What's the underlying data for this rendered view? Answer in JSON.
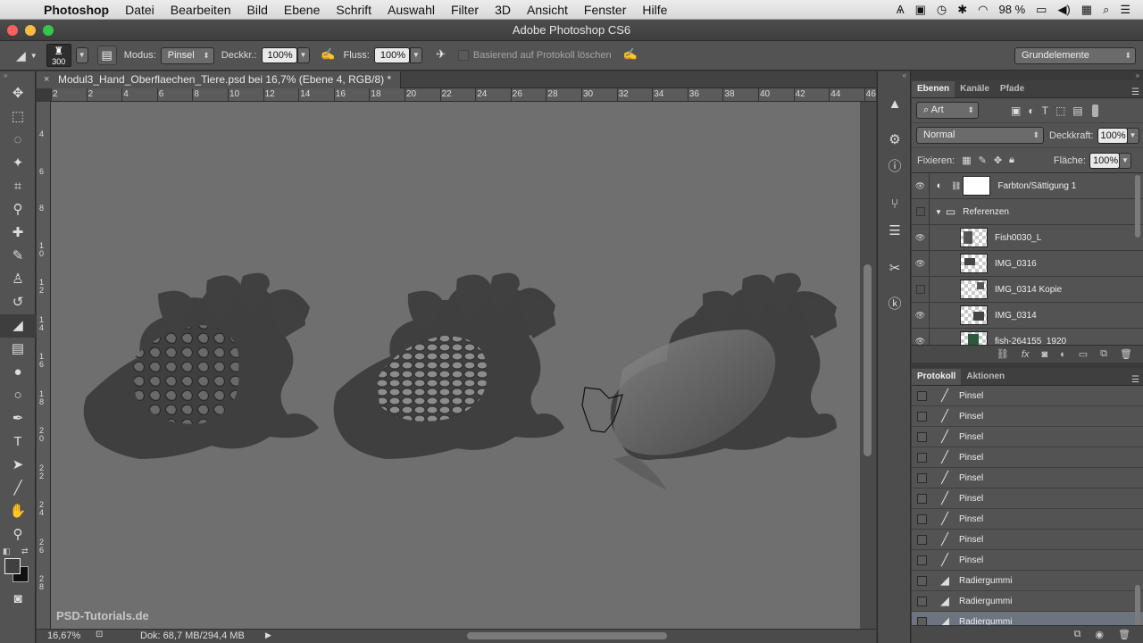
{
  "menubar": {
    "app": "Photoshop",
    "items": [
      "Datei",
      "Bearbeiten",
      "Bild",
      "Ebene",
      "Schrift",
      "Auswahl",
      "Filter",
      "3D",
      "Ansicht",
      "Fenster",
      "Hilfe"
    ],
    "battery": "98 %"
  },
  "window": {
    "title": "Adobe Photoshop CS6"
  },
  "options": {
    "brush_size": "300",
    "mode_label": "Modus:",
    "mode_value": "Pinsel",
    "opacity_label": "Deckkr.:",
    "opacity_value": "100%",
    "flow_label": "Fluss:",
    "flow_value": "100%",
    "history_erase_label": "Basierend auf Protokoll löschen",
    "workspace": "Grundelemente"
  },
  "document": {
    "tab_title": "Modul3_Hand_Oberflaechen_Tiere.psd bei 16,7% (Ebene 4, RGB/8) *",
    "ruler_h": [
      "2",
      "2",
      "4",
      "6",
      "8",
      "10",
      "12",
      "14",
      "16",
      "18",
      "20",
      "22",
      "24",
      "26",
      "28",
      "30",
      "32",
      "34",
      "36",
      "38",
      "40",
      "42",
      "44",
      "46"
    ],
    "ruler_v": [
      "4",
      "6",
      "8",
      "1\n0",
      "1\n2",
      "1\n4",
      "1\n6",
      "1\n8",
      "2\n0",
      "2\n2",
      "2\n4",
      "2\n6",
      "2\n8"
    ],
    "zoom": "16,67%",
    "doc_size": "Dok: 68,7 MB/294,4 MB",
    "watermark": "PSD-Tutorials.de"
  },
  "layers_panel": {
    "tabs": [
      "Ebenen",
      "Kanäle",
      "Pfade"
    ],
    "filter_kind": "Art",
    "blend_mode": "Normal",
    "opacity_label": "Deckkraft:",
    "opacity_value": "100%",
    "lock_label": "Fixieren:",
    "fill_label": "Fläche:",
    "fill_value": "100%",
    "layers": [
      {
        "name": "Farbton/Sättigung 1",
        "visible": true
      },
      {
        "name": "Referenzen",
        "visible": false,
        "group": true
      },
      {
        "name": "Fish0030_L",
        "visible": true
      },
      {
        "name": "IMG_0316",
        "visible": true
      },
      {
        "name": "IMG_0314 Kopie",
        "visible": false
      },
      {
        "name": "IMG_0314",
        "visible": true
      },
      {
        "name": "fish-264155_1920",
        "visible": true
      }
    ]
  },
  "history_panel": {
    "tabs": [
      "Protokoll",
      "Aktionen"
    ],
    "items": [
      "Pinsel",
      "Pinsel",
      "Pinsel",
      "Pinsel",
      "Pinsel",
      "Pinsel",
      "Pinsel",
      "Pinsel",
      "Pinsel",
      "Radiergummi",
      "Radiergummi",
      "Radiergummi"
    ]
  },
  "colors": {
    "canvas": "#6f6f6f",
    "panel": "#535353",
    "selected_history": "#6c7480"
  }
}
